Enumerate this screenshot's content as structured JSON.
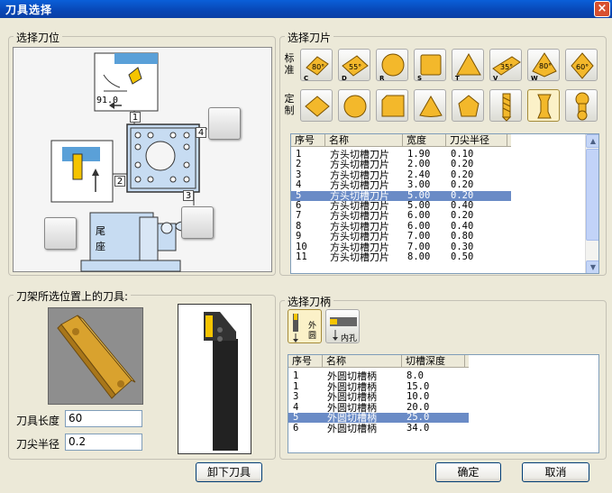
{
  "window": {
    "title": "刀具选择",
    "close": "×"
  },
  "position_group": {
    "title": "选择刀位",
    "angle_label": "91.0",
    "slot_numbers": [
      "1",
      "2",
      "3",
      "4"
    ],
    "tailstock_label": [
      "尾",
      "座"
    ]
  },
  "insert_group": {
    "title": "选择刀片",
    "standard_label": [
      "标",
      "准"
    ],
    "custom_label": [
      "定",
      "制"
    ],
    "standard_buttons": [
      {
        "icon": "diamond-80-insert-icon",
        "angle": "80°",
        "code": "C"
      },
      {
        "icon": "diamond-55-insert-icon",
        "angle": "55°",
        "code": "D"
      },
      {
        "icon": "round-insert-icon",
        "angle": "",
        "code": "R"
      },
      {
        "icon": "square-insert-icon",
        "angle": "",
        "code": "S"
      },
      {
        "icon": "triangle-insert-icon",
        "angle": "",
        "code": "T"
      },
      {
        "icon": "diamond-35-insert-icon",
        "angle": "35°",
        "code": "V"
      },
      {
        "icon": "trigon-80-insert-icon",
        "angle": "80°",
        "code": "W"
      },
      {
        "icon": "diamond-60-insert-icon",
        "angle": "60°",
        "code": ""
      }
    ],
    "custom_buttons": [
      {
        "icon": "custom-diamond-icon"
      },
      {
        "icon": "custom-round-icon"
      },
      {
        "icon": "custom-square-chamfer-icon"
      },
      {
        "icon": "custom-triangle-icon"
      },
      {
        "icon": "custom-pentagon-icon"
      },
      {
        "icon": "drill-icon"
      },
      {
        "icon": "grooving-insert-icon",
        "active": true
      },
      {
        "icon": "dogbone-insert-icon"
      }
    ],
    "columns": [
      "序号",
      "名称",
      "宽度",
      "刀尖半径"
    ],
    "rows": [
      [
        "1",
        "方头切槽刀片",
        "1.90",
        "0.10"
      ],
      [
        "2",
        "方头切槽刀片",
        "2.00",
        "0.20"
      ],
      [
        "3",
        "方头切槽刀片",
        "2.40",
        "0.20"
      ],
      [
        "4",
        "方头切槽刀片",
        "3.00",
        "0.20"
      ],
      [
        "5",
        "方头切槽刀片",
        "5.00",
        "0.20"
      ],
      [
        "6",
        "方头切槽刀片",
        "5.00",
        "0.40"
      ],
      [
        "7",
        "方头切槽刀片",
        "6.00",
        "0.20"
      ],
      [
        "8",
        "方头切槽刀片",
        "6.00",
        "0.40"
      ],
      [
        "9",
        "方头切槽刀片",
        "7.00",
        "0.80"
      ],
      [
        "10",
        "方头切槽刀片",
        "7.00",
        "0.30"
      ],
      [
        "11",
        "方头切槽刀片",
        "8.00",
        "0.50"
      ]
    ],
    "selected_index": 4
  },
  "current_tool_group": {
    "title": "刀架所选位置上的刀具:",
    "length_label": "刀具长度",
    "length_value": "60",
    "radius_label": "刀尖半径",
    "radius_value": "0.2"
  },
  "holder_group": {
    "title": "选择刀柄",
    "type_buttons": [
      {
        "icon": "external-holder-icon",
        "label": [
          "外",
          "圆"
        ],
        "active": true
      },
      {
        "icon": "internal-holder-icon",
        "label": [
          "内孔"
        ],
        "active": false
      }
    ],
    "columns": [
      "序号",
      "名称",
      "切槽深度"
    ],
    "rows": [
      [
        "1",
        "外圆切槽柄",
        "8.0"
      ],
      [
        "1",
        "外圆切槽柄",
        "15.0"
      ],
      [
        "3",
        "外圆切槽柄",
        "10.0"
      ],
      [
        "4",
        "外圆切槽柄",
        "20.0"
      ],
      [
        "5",
        "外圆切槽柄",
        "25.0"
      ],
      [
        "6",
        "外圆切槽柄",
        "34.0"
      ]
    ],
    "selected_index": 4
  },
  "buttons": {
    "unload": "卸下刀具",
    "ok": "确定",
    "cancel": "取消"
  },
  "colors": {
    "title_bar": "#0846b5",
    "selection": "#6a8bc6",
    "insert_gold": "#d9a22e",
    "turret_blue": "#c7dcf2"
  }
}
